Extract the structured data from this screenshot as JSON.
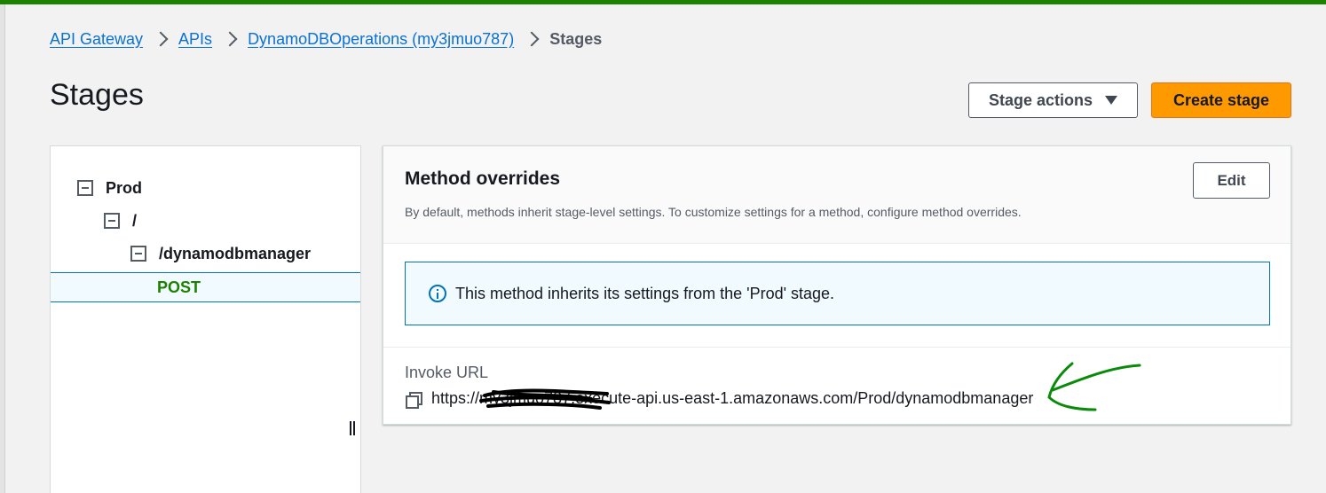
{
  "breadcrumb": {
    "items": [
      "API Gateway",
      "APIs",
      "DynamoDBOperations (my3jmuo787)"
    ],
    "current": "Stages"
  },
  "page": {
    "title": "Stages"
  },
  "header_actions": {
    "stage_actions_label": "Stage actions",
    "create_stage_label": "Create stage"
  },
  "tree": {
    "stage": "Prod",
    "root": "/",
    "resource": "/dynamodbmanager",
    "method": "POST"
  },
  "method_overrides": {
    "title": "Method overrides",
    "description": "By default, methods inherit stage-level settings. To customize settings for a method, configure method overrides.",
    "edit_label": "Edit",
    "info_message": "This method inherits its settings from the 'Prod' stage."
  },
  "invoke": {
    "label": "Invoke URL",
    "url": "https://my3jmuo787.execute-api.us-east-1.amazonaws.com/Prod/dynamodbmanager"
  },
  "colors": {
    "accent_orange": "#ff9900",
    "link_blue": "#0972d3",
    "selected_method_green": "#1d8102",
    "info_border": "#0073bb",
    "annotation_green": "#0a8a0a"
  },
  "icons": [
    "chevron-right-icon",
    "caret-down-icon",
    "collapse-icon",
    "info-icon",
    "copy-icon"
  ]
}
